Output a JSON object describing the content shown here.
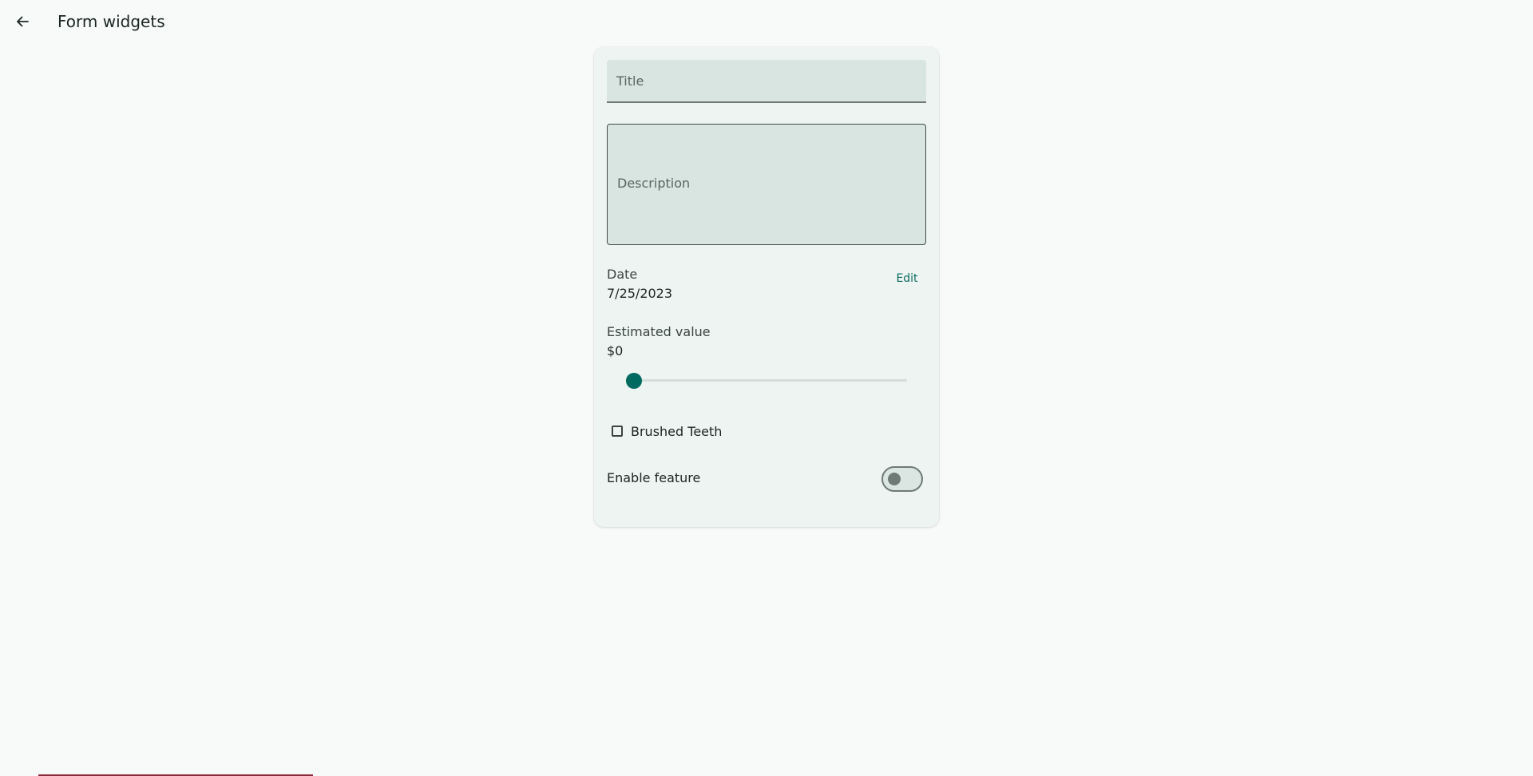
{
  "app_bar": {
    "back_icon": "arrow-left-icon",
    "title": "Form widgets"
  },
  "form": {
    "title_placeholder": "Title",
    "description_placeholder": "Description",
    "date": {
      "label": "Date",
      "value": "7/25/2023",
      "edit_label": "Edit"
    },
    "estimated_value": {
      "label": "Estimated value",
      "display": "$0",
      "slider_fraction": 0
    },
    "checkbox": {
      "label": "Brushed Teeth",
      "checked": false
    },
    "feature": {
      "label": "Enable feature",
      "enabled": false
    }
  },
  "colors": {
    "background": "#f7faf8",
    "card": "#edf4f1",
    "field": "#d9e5e0",
    "accent": "#006a60",
    "outline": "#6f7975"
  }
}
